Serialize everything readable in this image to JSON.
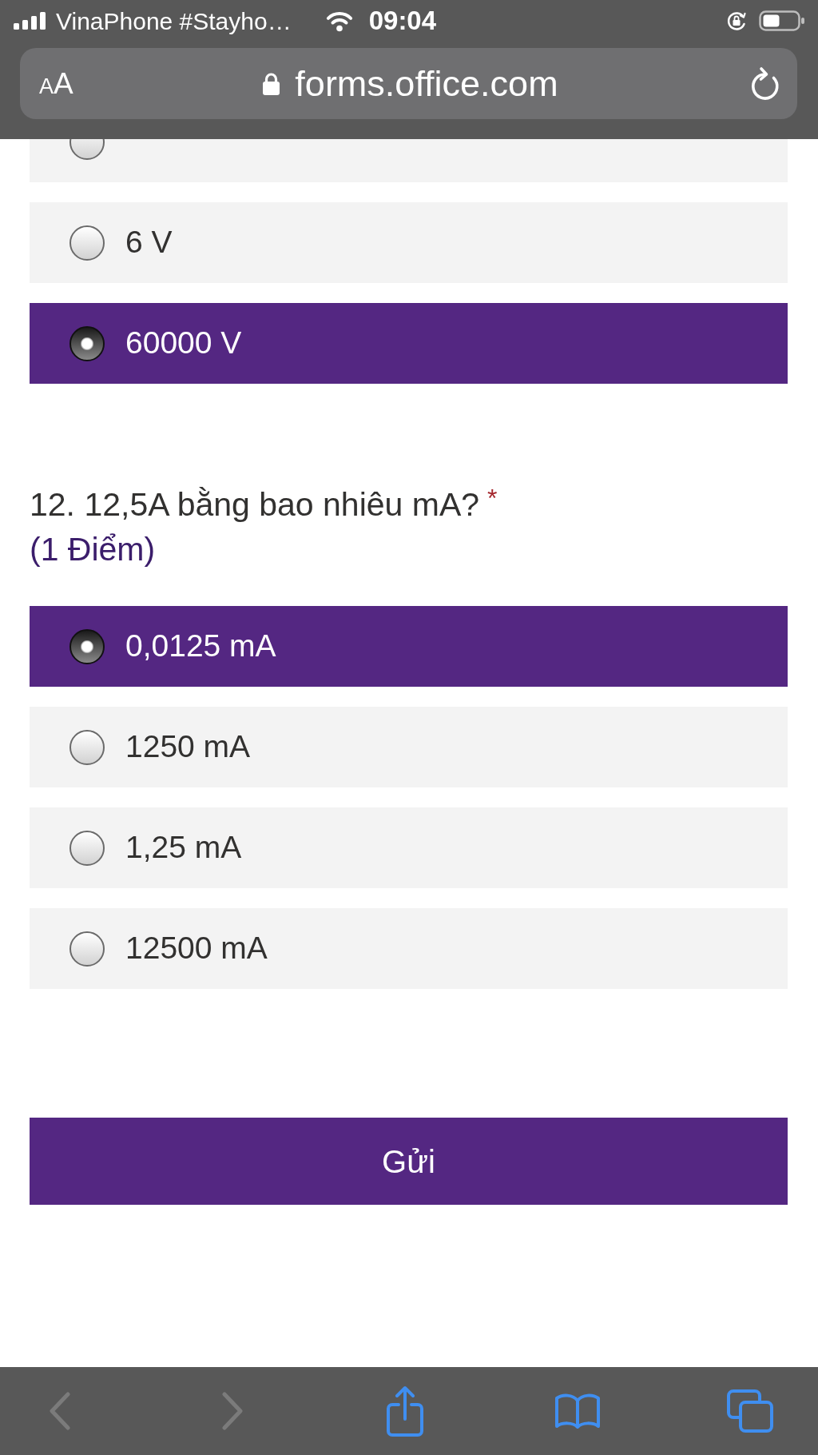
{
  "status_bar": {
    "carrier": "VinaPhone #Stayho…",
    "time": "09:04"
  },
  "address_bar": {
    "text_size_button": {
      "small_letter": "A",
      "large_letter": "A"
    },
    "url": "forms.office.com"
  },
  "questions": [
    {
      "options": [
        {
          "selected": false
        },
        {
          "label": "6 V",
          "selected": false
        },
        {
          "label": "60000 V",
          "selected": true
        }
      ]
    },
    {
      "title": "12. 12,5A bằng bao nhiêu mA?",
      "required_mark": "*",
      "points": "(1 Điểm)",
      "options": [
        {
          "label": "0,0125 mA",
          "selected": true
        },
        {
          "label": "1250 mA",
          "selected": false
        },
        {
          "label": "1,25 mA",
          "selected": false
        },
        {
          "label": "12500 mA",
          "selected": false
        }
      ]
    }
  ],
  "submit_button": {
    "label": "Gửi"
  },
  "toolbar": {
    "buttons": [
      {
        "kind": "back",
        "disabled": true
      },
      {
        "kind": "forward",
        "disabled": true
      },
      {
        "kind": "share",
        "disabled": false
      },
      {
        "kind": "bookmarks",
        "disabled": false
      },
      {
        "kind": "tabs",
        "disabled": false
      }
    ]
  }
}
